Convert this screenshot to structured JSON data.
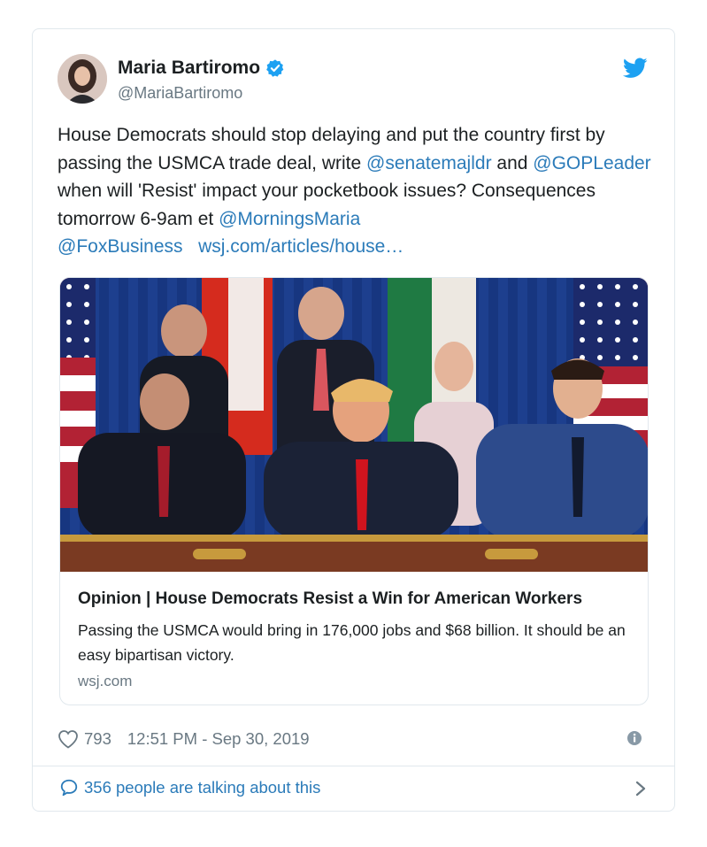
{
  "author": {
    "display_name": "Maria Bartiromo",
    "handle": "@MariaBartiromo",
    "avatar": "profile-photo",
    "verified_icon": "verified-badge-icon"
  },
  "platform_icon": "twitter-bird-icon",
  "tweet": {
    "text_1": "House Democrats should stop delaying and put the country first by passing the USMCA trade deal, write ",
    "mention_1": "@senatemajldr",
    "text_2": " and ",
    "mention_2": "@GOPLeader",
    "text_3": " when will 'Resist' impact your pocketbook issues? Consequences tomorrow 6-9am et  ",
    "mention_3": "@MorningsMaria",
    "mention_4": "@FoxBusiness",
    "link": "wsj.com/articles/house…"
  },
  "card": {
    "image": "photo of leaders signing trade agreement in front of flags",
    "title": "Opinion | House Democrats Resist a Win for American Workers",
    "description": "Passing the USMCA would bring in 176,000 jobs and $68 billion. It should be an easy bipartisan victory.",
    "domain": "wsj.com"
  },
  "meta": {
    "likes": "793",
    "timestamp": "12:51 PM - Sep 30, 2019",
    "info_icon": "info-icon"
  },
  "conversation": {
    "label": "356 people are talking about this",
    "icon": "speech-bubble-icon",
    "chevron": "chevron-right-icon"
  },
  "colors": {
    "link": "#2b7bb9",
    "secondary_text": "#697882",
    "border": "#e1e8ed",
    "twitter_blue": "#1da1f2"
  }
}
